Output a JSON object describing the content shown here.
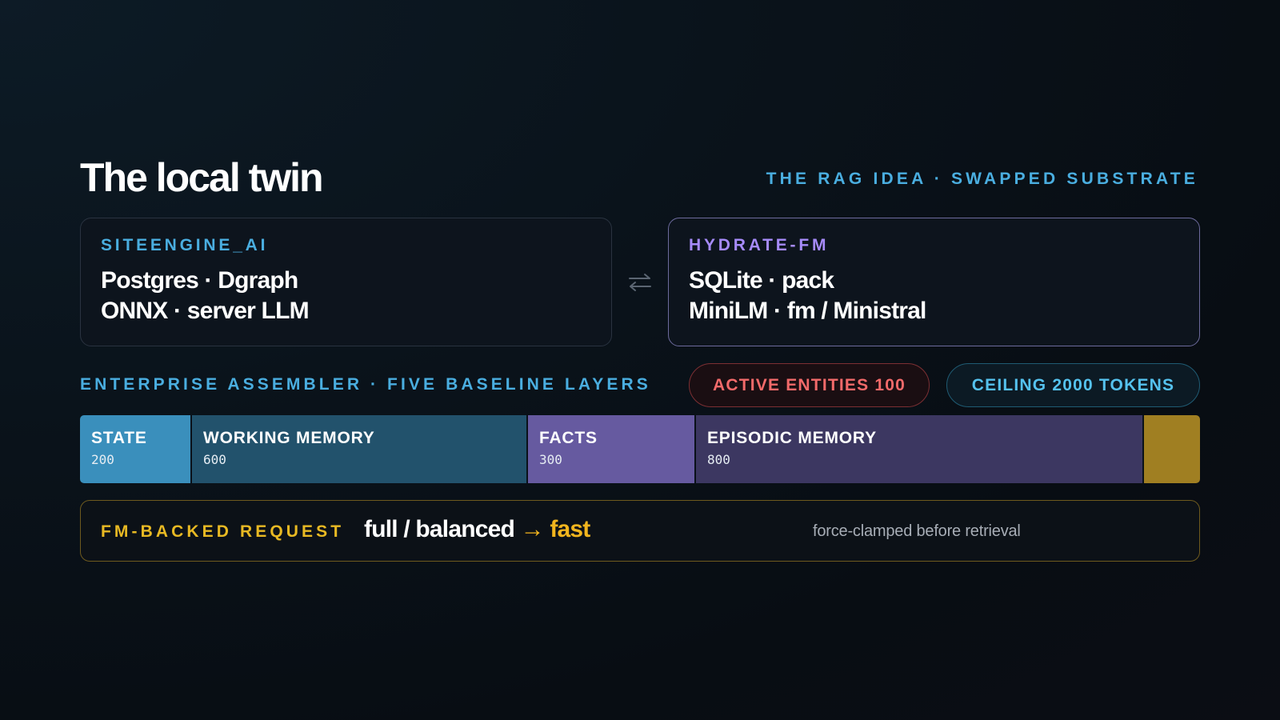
{
  "title": "The local twin",
  "kicker": "THE RAG IDEA · SWAPPED SUBSTRATE",
  "cards": [
    {
      "label": "SITEENGINE_AI",
      "lines": [
        "Postgres · Dgraph",
        "ONNX · server LLM"
      ],
      "accent": "#4aaee0"
    },
    {
      "label": "HYDRATE-FM",
      "lines": [
        "SQLite · pack",
        "MiniLM · fm / Ministral"
      ],
      "accent": "#a78bfa"
    }
  ],
  "swap_icon": "swap-arrows-icon",
  "layers": {
    "label": "ENTERPRISE ASSEMBLER · FIVE BASELINE LAYERS",
    "pills": {
      "active_entities": "ACTIVE ENTITIES 100",
      "ceiling": "CEILING 2000 TOKENS"
    },
    "segments": [
      {
        "name": "STATE",
        "value": "200",
        "color": "#3a8fbc"
      },
      {
        "name": "WORKING MEMORY",
        "value": "600",
        "color": "#22526c"
      },
      {
        "name": "FACTS",
        "value": "300",
        "color": "#665aa0"
      },
      {
        "name": "EPISODIC MEMORY",
        "value": "800",
        "color": "#3c3761"
      },
      {
        "name": "",
        "value": "100",
        "color": "#a07f22"
      }
    ]
  },
  "request": {
    "label": "FM-BACKED REQUEST",
    "modes": "full / balanced",
    "arrow": "→",
    "target": "fast",
    "note": "force-clamped before retrieval"
  }
}
